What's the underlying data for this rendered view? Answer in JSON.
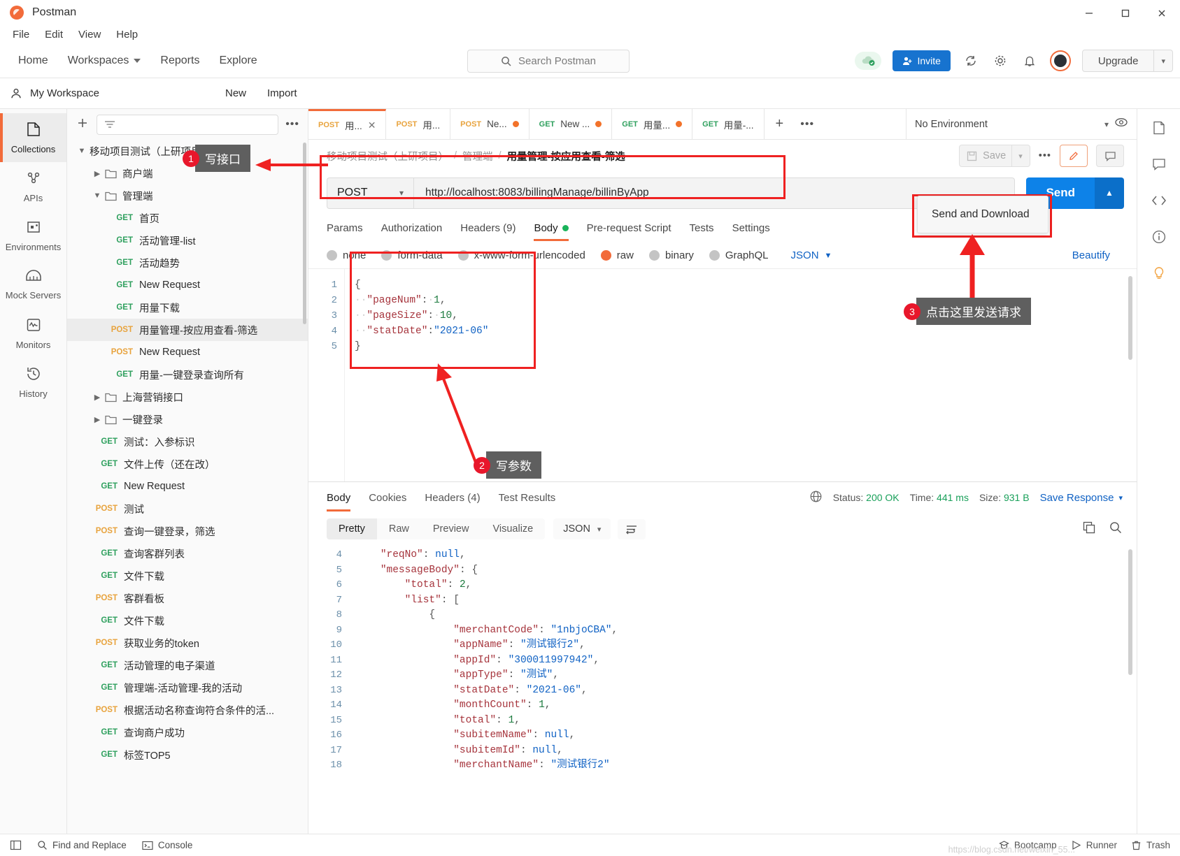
{
  "window": {
    "title": "Postman",
    "minimize": "—",
    "maximize": "☐",
    "close": "✕"
  },
  "menubar": [
    "File",
    "Edit",
    "View",
    "Help"
  ],
  "topnav": {
    "links": [
      "Home",
      "Workspaces",
      "Reports",
      "Explore"
    ],
    "search_placeholder": "Search Postman",
    "invite_label": "Invite",
    "upgrade_label": "Upgrade"
  },
  "workspace": {
    "name": "My Workspace",
    "new_label": "New",
    "import_label": "Import"
  },
  "rail": [
    {
      "label": "Collections",
      "icon": "collections-icon",
      "active": true
    },
    {
      "label": "APIs",
      "icon": "apis-icon",
      "active": false
    },
    {
      "label": "Environments",
      "icon": "environments-icon",
      "active": false
    },
    {
      "label": "Mock Servers",
      "icon": "mock-servers-icon",
      "active": false
    },
    {
      "label": "Monitors",
      "icon": "monitors-icon",
      "active": false
    },
    {
      "label": "History",
      "icon": "history-icon",
      "active": false
    }
  ],
  "tree": [
    {
      "type": "collection",
      "chev": "v",
      "label": "移动项目测试（上研项目）",
      "indent": 0
    },
    {
      "type": "folder",
      "chev": ">",
      "label": "商户端",
      "indent": 1
    },
    {
      "type": "folder",
      "chev": "v",
      "label": "管理端",
      "indent": 1
    },
    {
      "type": "request",
      "method": "GET",
      "label": "首页",
      "indent": 2
    },
    {
      "type": "request",
      "method": "GET",
      "label": "活动管理-list",
      "indent": 2
    },
    {
      "type": "request",
      "method": "GET",
      "label": "活动趋势",
      "indent": 2
    },
    {
      "type": "request",
      "method": "GET",
      "label": "New Request",
      "indent": 2
    },
    {
      "type": "request",
      "method": "GET",
      "label": "用量下载",
      "indent": 2
    },
    {
      "type": "request",
      "method": "POST",
      "label": "用量管理-按应用查看-筛选",
      "indent": 2,
      "selected": true
    },
    {
      "type": "request",
      "method": "POST",
      "label": "New Request",
      "indent": 2
    },
    {
      "type": "request",
      "method": "GET",
      "label": "用量-一键登录查询所有",
      "indent": 2
    },
    {
      "type": "folder",
      "chev": ">",
      "label": "上海营销接口",
      "indent": 1
    },
    {
      "type": "folder",
      "chev": ">",
      "label": "一键登录",
      "indent": 1
    },
    {
      "type": "request",
      "method": "GET",
      "label": "测试：入参标识",
      "indent": 1
    },
    {
      "type": "request",
      "method": "GET",
      "label": "文件上传（还在改）",
      "indent": 1
    },
    {
      "type": "request",
      "method": "GET",
      "label": "New Request",
      "indent": 1
    },
    {
      "type": "request",
      "method": "POST",
      "label": "测试",
      "indent": 1
    },
    {
      "type": "request",
      "method": "POST",
      "label": "查询一键登录，筛选",
      "indent": 1
    },
    {
      "type": "request",
      "method": "GET",
      "label": "查询客群列表",
      "indent": 1
    },
    {
      "type": "request",
      "method": "GET",
      "label": "文件下载",
      "indent": 1
    },
    {
      "type": "request",
      "method": "POST",
      "label": "客群看板",
      "indent": 1
    },
    {
      "type": "request",
      "method": "GET",
      "label": "文件下载",
      "indent": 1
    },
    {
      "type": "request",
      "method": "POST",
      "label": "获取业务的token",
      "indent": 1
    },
    {
      "type": "request",
      "method": "GET",
      "label": "活动管理的电子渠道",
      "indent": 1
    },
    {
      "type": "request",
      "method": "GET",
      "label": "管理端-活动管理-我的活动",
      "indent": 1
    },
    {
      "type": "request",
      "method": "POST",
      "label": "根据活动名称查询符合条件的活...",
      "indent": 1
    },
    {
      "type": "request",
      "method": "GET",
      "label": "查询商户成功",
      "indent": 1
    },
    {
      "type": "request",
      "method": "GET",
      "label": "标签TOP5",
      "indent": 1
    }
  ],
  "tabs": [
    {
      "method": "POST",
      "label": "用...",
      "active": true,
      "close": true
    },
    {
      "method": "POST",
      "label": "用...",
      "active": false
    },
    {
      "method": "POST",
      "label": "Ne...",
      "active": false,
      "unsaved": true
    },
    {
      "method": "GET",
      "label": "New ...",
      "active": false,
      "unsaved": true
    },
    {
      "method": "GET",
      "label": "用量...",
      "active": false,
      "unsaved": true
    },
    {
      "method": "GET",
      "label": "用量-...",
      "active": false
    }
  ],
  "environment": {
    "selected": "No Environment"
  },
  "breadcrumb": {
    "collection": "移动项目测试（上研项目）",
    "folder": "管理端",
    "current": "用量管理-按应用查看-筛选",
    "separator": "/",
    "save_label": "Save"
  },
  "request": {
    "method": "POST",
    "url": "http://localhost:8083/billingManage/billinByApp",
    "send_label": "Send",
    "send_menu_item": "Send and Download",
    "tabs": [
      {
        "label": "Params",
        "active": false
      },
      {
        "label": "Authorization",
        "active": false
      },
      {
        "label": "Headers (9)",
        "active": false
      },
      {
        "label": "Body",
        "active": true,
        "dot": true
      },
      {
        "label": "Pre-request Script",
        "active": false
      },
      {
        "label": "Tests",
        "active": false
      },
      {
        "label": "Settings",
        "active": false
      }
    ],
    "body_types": [
      {
        "label": "none",
        "selected": false
      },
      {
        "label": "form-data",
        "selected": false
      },
      {
        "label": "x-www-form-urlencoded",
        "selected": false
      },
      {
        "label": "raw",
        "selected": true
      },
      {
        "label": "binary",
        "selected": false
      },
      {
        "label": "GraphQL",
        "selected": false
      }
    ],
    "raw_format": "JSON",
    "beautify_label": "Beautify",
    "body_lines": [
      {
        "n": 1,
        "segments": [
          {
            "t": "{",
            "c": "p"
          }
        ]
      },
      {
        "n": 2,
        "segments": [
          {
            "t": "··",
            "c": "dotspc"
          },
          {
            "t": "\"pageNum\"",
            "c": "k"
          },
          {
            "t": ":",
            "c": "p"
          },
          {
            "t": "·",
            "c": "dotspc"
          },
          {
            "t": "1",
            "c": "n"
          },
          {
            "t": ",",
            "c": "p"
          }
        ]
      },
      {
        "n": 3,
        "segments": [
          {
            "t": "··",
            "c": "dotspc"
          },
          {
            "t": "\"pageSize\"",
            "c": "k"
          },
          {
            "t": ":",
            "c": "p"
          },
          {
            "t": "·",
            "c": "dotspc"
          },
          {
            "t": "10",
            "c": "n"
          },
          {
            "t": ",",
            "c": "p"
          }
        ]
      },
      {
        "n": 4,
        "segments": [
          {
            "t": "··",
            "c": "dotspc"
          },
          {
            "t": "\"statDate\"",
            "c": "k"
          },
          {
            "t": ":",
            "c": "p"
          },
          {
            "t": "\"2021-06\"",
            "c": "s"
          }
        ]
      },
      {
        "n": 5,
        "segments": [
          {
            "t": "}",
            "c": "p"
          }
        ]
      }
    ]
  },
  "response": {
    "tabs": [
      {
        "label": "Body",
        "active": true
      },
      {
        "label": "Cookies",
        "active": false
      },
      {
        "label": "Headers (4)",
        "active": false
      },
      {
        "label": "Test Results",
        "active": false
      }
    ],
    "status_label": "Status:",
    "status_value": "200 OK",
    "time_label": "Time:",
    "time_value": "441 ms",
    "size_label": "Size:",
    "size_value": "931 B",
    "save_response": "Save Response",
    "view_modes": [
      {
        "label": "Pretty",
        "active": true
      },
      {
        "label": "Raw",
        "active": false
      },
      {
        "label": "Preview",
        "active": false
      },
      {
        "label": "Visualize",
        "active": false
      }
    ],
    "format": "JSON",
    "lines": [
      {
        "n": 4,
        "indent": 1,
        "segments": [
          {
            "t": "\"reqNo\"",
            "c": "k"
          },
          {
            "t": ": ",
            "c": "p"
          },
          {
            "t": "null",
            "c": "s"
          },
          {
            "t": ",",
            "c": "p"
          }
        ]
      },
      {
        "n": 5,
        "indent": 1,
        "segments": [
          {
            "t": "\"messageBody\"",
            "c": "k"
          },
          {
            "t": ": {",
            "c": "p"
          }
        ]
      },
      {
        "n": 6,
        "indent": 2,
        "segments": [
          {
            "t": "\"total\"",
            "c": "k"
          },
          {
            "t": ": ",
            "c": "p"
          },
          {
            "t": "2",
            "c": "n"
          },
          {
            "t": ",",
            "c": "p"
          }
        ]
      },
      {
        "n": 7,
        "indent": 2,
        "segments": [
          {
            "t": "\"list\"",
            "c": "k"
          },
          {
            "t": ": [",
            "c": "p"
          }
        ]
      },
      {
        "n": 8,
        "indent": 3,
        "segments": [
          {
            "t": "{",
            "c": "p"
          }
        ]
      },
      {
        "n": 9,
        "indent": 4,
        "segments": [
          {
            "t": "\"merchantCode\"",
            "c": "k"
          },
          {
            "t": ": ",
            "c": "p"
          },
          {
            "t": "\"1nbjoCBA\"",
            "c": "s"
          },
          {
            "t": ",",
            "c": "p"
          }
        ]
      },
      {
        "n": 10,
        "indent": 4,
        "segments": [
          {
            "t": "\"appName\"",
            "c": "k"
          },
          {
            "t": ": ",
            "c": "p"
          },
          {
            "t": "\"测试银行2\"",
            "c": "s"
          },
          {
            "t": ",",
            "c": "p"
          }
        ]
      },
      {
        "n": 11,
        "indent": 4,
        "segments": [
          {
            "t": "\"appId\"",
            "c": "k"
          },
          {
            "t": ": ",
            "c": "p"
          },
          {
            "t": "\"300011997942\"",
            "c": "s"
          },
          {
            "t": ",",
            "c": "p"
          }
        ]
      },
      {
        "n": 12,
        "indent": 4,
        "segments": [
          {
            "t": "\"appType\"",
            "c": "k"
          },
          {
            "t": ": ",
            "c": "p"
          },
          {
            "t": "\"测试\"",
            "c": "s"
          },
          {
            "t": ",",
            "c": "p"
          }
        ]
      },
      {
        "n": 13,
        "indent": 4,
        "segments": [
          {
            "t": "\"statDate\"",
            "c": "k"
          },
          {
            "t": ": ",
            "c": "p"
          },
          {
            "t": "\"2021-06\"",
            "c": "s"
          },
          {
            "t": ",",
            "c": "p"
          }
        ]
      },
      {
        "n": 14,
        "indent": 4,
        "segments": [
          {
            "t": "\"monthCount\"",
            "c": "k"
          },
          {
            "t": ": ",
            "c": "p"
          },
          {
            "t": "1",
            "c": "n"
          },
          {
            "t": ",",
            "c": "p"
          }
        ]
      },
      {
        "n": 15,
        "indent": 4,
        "segments": [
          {
            "t": "\"total\"",
            "c": "k"
          },
          {
            "t": ": ",
            "c": "p"
          },
          {
            "t": "1",
            "c": "n"
          },
          {
            "t": ",",
            "c": "p"
          }
        ]
      },
      {
        "n": 16,
        "indent": 4,
        "segments": [
          {
            "t": "\"subitemName\"",
            "c": "k"
          },
          {
            "t": ": ",
            "c": "p"
          },
          {
            "t": "null",
            "c": "s"
          },
          {
            "t": ",",
            "c": "p"
          }
        ]
      },
      {
        "n": 17,
        "indent": 4,
        "segments": [
          {
            "t": "\"subitemId\"",
            "c": "k"
          },
          {
            "t": ": ",
            "c": "p"
          },
          {
            "t": "null",
            "c": "s"
          },
          {
            "t": ",",
            "c": "p"
          }
        ]
      },
      {
        "n": 18,
        "indent": 4,
        "segments": [
          {
            "t": "\"merchantName\"",
            "c": "k"
          },
          {
            "t": ": ",
            "c": "p"
          },
          {
            "t": "\"测试银行2\"",
            "c": "s"
          }
        ]
      }
    ]
  },
  "annotations": [
    {
      "num": "1",
      "text": "写接口"
    },
    {
      "num": "2",
      "text": "写参数"
    },
    {
      "num": "3",
      "text": "点击这里发送请求"
    }
  ],
  "statusbar": {
    "find_replace": "Find and Replace",
    "console": "Console",
    "bootcamp": "Bootcamp",
    "runner": "Runner",
    "trash": "Trash"
  }
}
